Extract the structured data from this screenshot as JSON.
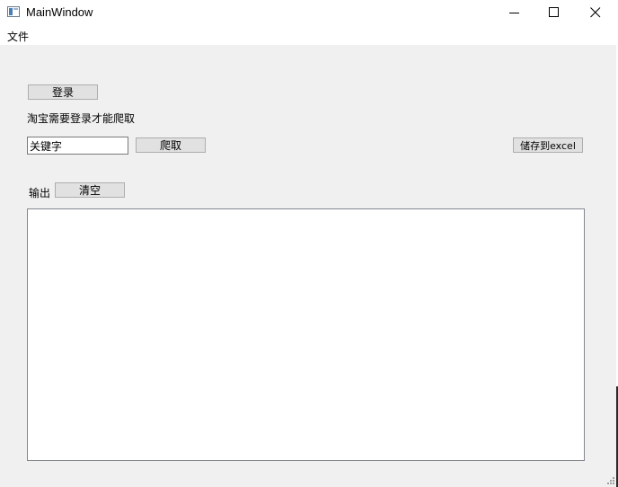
{
  "window": {
    "title": "MainWindow"
  },
  "menu": {
    "items": [
      "文件"
    ]
  },
  "buttons": {
    "login": "登录",
    "crawl": "爬取",
    "save_excel": "储存到excel",
    "clear": "清空"
  },
  "labels": {
    "login_hint": "淘宝需要登录才能爬取",
    "output": "输出"
  },
  "inputs": {
    "keyword_value": "关键字"
  },
  "output": {
    "text": ""
  }
}
